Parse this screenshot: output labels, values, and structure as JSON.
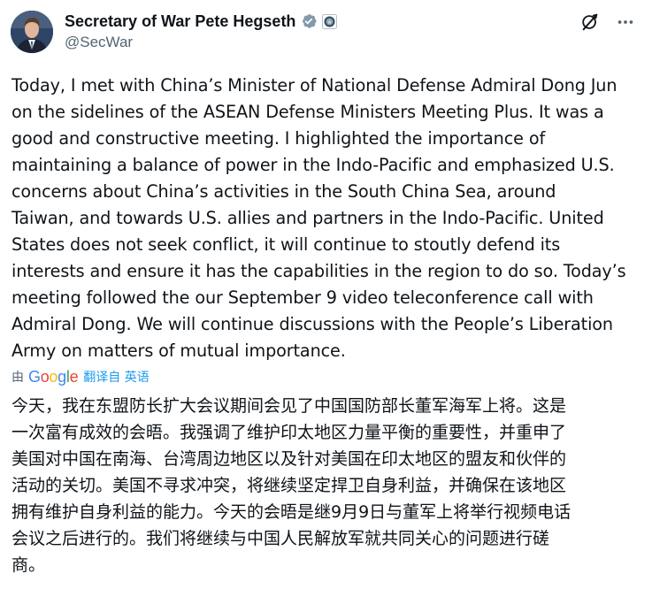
{
  "author": {
    "display_name": "Secretary of War Pete Hegseth",
    "handle": "@SecWar",
    "avatar_icon": "avatar-photo",
    "verified_icon": "verified-badge-icon",
    "affiliate_icon": "department-seal-icon"
  },
  "actions": {
    "grok_icon": "grok-icon",
    "more_icon": "more-options-icon"
  },
  "tweet": {
    "text": "Today, I met with China’s Minister of National Defense Admiral Dong Jun\non the sidelines of the ASEAN Defense Ministers Meeting Plus. It was a\ngood and constructive meeting. I highlighted the importance of\nmaintaining a balance of power in the Indo-Pacific and emphasized U.S.\nconcerns about China’s activities in the South China Sea, around\nTaiwan, and towards U.S. allies and partners in the Indo-Pacific. United\nStates does not seek conflict, it will continue to stoutly defend its\ninterests and ensure it has the capabilities in the region to do so. Today’s\nmeeting followed the our September 9 video teleconference call with\nAdmiral Dong. We will continue discussions with the People’s Liberation\nArmy on matters of mutual importance."
  },
  "translation": {
    "by_label": "由",
    "provider": "Google",
    "link_label": "翻译自 英语",
    "text": "今天，我在东盟防长扩大会议期间会见了中国国防部长董军海军上将。这是\n一次富有成效的会晤。我强调了维护印太地区力量平衡的重要性，并重申了\n美国对中国在南海、台湾周边地区以及针对美国在印太地区的盟友和伙伴的\n活动的关切。美国不寻求冲突，将继续坚定捍卫自身利益，并确保在该地区\n拥有维护自身利益的能力。今天的会晤是继9月9日与董军上将举行视频电话\n会议之后进行的。我们将继续与中国人民解放军就共同关心的问题进行磋\n商。"
  },
  "colors": {
    "text": "#0f1419",
    "secondary": "#536471",
    "link": "#1d9bf0",
    "verified": "#829aab"
  }
}
